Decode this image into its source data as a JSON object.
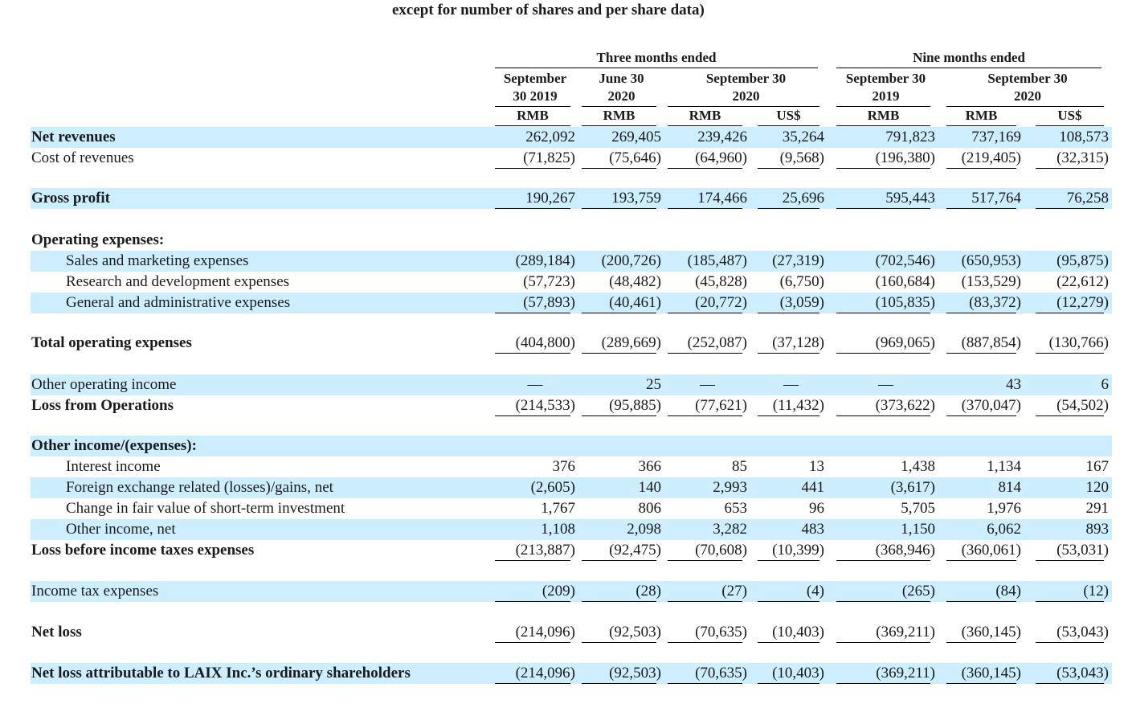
{
  "caption": "except for number of shares and per share data)",
  "groups": [
    {
      "label": "Three months ended"
    },
    {
      "label": "Nine months ended"
    }
  ],
  "columns": [
    {
      "line1": "September",
      "line2": "30 2019",
      "currency": "RMB"
    },
    {
      "line1": "June 30",
      "line2": "2020",
      "currency": "RMB"
    },
    {
      "line1": "September 30",
      "line2": "2020",
      "currency": "RMB"
    },
    {
      "line1": "",
      "line2": "",
      "currency": "US$"
    },
    {
      "line1": "September 30",
      "line2": "2019",
      "currency": "RMB"
    },
    {
      "line1": "September 30",
      "line2": "2020",
      "currency": "RMB"
    },
    {
      "line1": "",
      "line2": "",
      "currency": "US$"
    }
  ],
  "rows": [
    {
      "label": "Net revenues",
      "bold": true,
      "indent": false,
      "band": true,
      "values": [
        "262,092",
        "269,405",
        "239,426",
        "35,264",
        "791,823",
        "737,169",
        "108,573"
      ]
    },
    {
      "label": "Cost of revenues",
      "bold": false,
      "indent": false,
      "band": false,
      "values": [
        "(71,825)",
        "(75,646)",
        "(64,960)",
        "(9,568)",
        "(196,380)",
        "(219,405)",
        "(32,315)"
      ]
    },
    {
      "label": "Gross profit",
      "bold": true,
      "indent": false,
      "band": true,
      "values": [
        "190,267",
        "193,759",
        "174,466",
        "25,696",
        "595,443",
        "517,764",
        "76,258"
      ]
    },
    {
      "label": "Operating expenses:",
      "bold": true,
      "indent": false,
      "band": false,
      "values": [
        "",
        "",
        "",
        "",
        "",
        "",
        ""
      ]
    },
    {
      "label": "Sales and marketing expenses",
      "bold": false,
      "indent": true,
      "band": true,
      "values": [
        "(289,184)",
        "(200,726)",
        "(185,487)",
        "(27,319)",
        "(702,546)",
        "(650,953)",
        "(95,875)"
      ]
    },
    {
      "label": "Research and development expenses",
      "bold": false,
      "indent": true,
      "band": false,
      "values": [
        "(57,723)",
        "(48,482)",
        "(45,828)",
        "(6,750)",
        "(160,684)",
        "(153,529)",
        "(22,612)"
      ]
    },
    {
      "label": "General and administrative expenses",
      "bold": false,
      "indent": true,
      "band": true,
      "values": [
        "(57,893)",
        "(40,461)",
        "(20,772)",
        "(3,059)",
        "(105,835)",
        "(83,372)",
        "(12,279)"
      ]
    },
    {
      "label": "Total operating expenses",
      "bold": true,
      "indent": false,
      "band": false,
      "values": [
        "(404,800)",
        "(289,669)",
        "(252,087)",
        "(37,128)",
        "(969,065)",
        "(887,854)",
        "(130,766)"
      ]
    },
    {
      "label": "Other operating income",
      "bold": false,
      "indent": false,
      "band": true,
      "values": [
        "—",
        "25",
        "—",
        "—",
        "—",
        "43",
        "6"
      ]
    },
    {
      "label": "Loss from Operations",
      "bold": true,
      "indent": false,
      "band": false,
      "values": [
        "(214,533)",
        "(95,885)",
        "(77,621)",
        "(11,432)",
        "(373,622)",
        "(370,047)",
        "(54,502)"
      ]
    },
    {
      "label": "Other income/(expenses):",
      "bold": true,
      "indent": false,
      "band": true,
      "values": [
        "",
        "",
        "",
        "",
        "",
        "",
        ""
      ]
    },
    {
      "label": "Interest income",
      "bold": false,
      "indent": true,
      "band": false,
      "values": [
        "376",
        "366",
        "85",
        "13",
        "1,438",
        "1,134",
        "167"
      ]
    },
    {
      "label": "Foreign exchange related (losses)/gains, net",
      "bold": false,
      "indent": true,
      "band": true,
      "values": [
        "(2,605)",
        "140",
        "2,993",
        "441",
        "(3,617)",
        "814",
        "120"
      ]
    },
    {
      "label": "Change in fair value of short-term investment",
      "bold": false,
      "indent": true,
      "band": false,
      "values": [
        "1,767",
        "806",
        "653",
        "96",
        "5,705",
        "1,976",
        "291"
      ]
    },
    {
      "label": "Other income, net",
      "bold": false,
      "indent": true,
      "band": true,
      "values": [
        "1,108",
        "2,098",
        "3,282",
        "483",
        "1,150",
        "6,062",
        "893"
      ]
    },
    {
      "label": "Loss before income taxes expenses",
      "bold": true,
      "indent": false,
      "band": false,
      "values": [
        "(213,887)",
        "(92,475)",
        "(70,608)",
        "(10,399)",
        "(368,946)",
        "(360,061)",
        "(53,031)"
      ]
    },
    {
      "label": "Income tax expenses",
      "bold": false,
      "indent": false,
      "band": true,
      "values": [
        "(209)",
        "(28)",
        "(27)",
        "(4)",
        "(265)",
        "(84)",
        "(12)"
      ]
    },
    {
      "label": "Net loss",
      "bold": true,
      "indent": false,
      "band": false,
      "values": [
        "(214,096)",
        "(92,503)",
        "(70,635)",
        "(10,403)",
        "(369,211)",
        "(360,145)",
        "(53,043)"
      ]
    },
    {
      "label": "Net loss attributable to LAIX Inc.’s ordinary shareholders",
      "bold": true,
      "indent": false,
      "band": true,
      "values": [
        "(214,096)",
        "(92,503)",
        "(70,635)",
        "(10,403)",
        "(369,211)",
        "(360,145)",
        "(53,043)"
      ]
    }
  ]
}
